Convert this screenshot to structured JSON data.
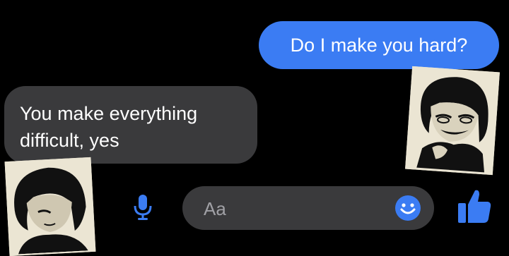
{
  "messages": [
    {
      "direction": "outgoing",
      "text": "Do I make you hard?"
    },
    {
      "direction": "incoming",
      "lines": [
        "You make everything",
        "difficult, yes"
      ]
    }
  ],
  "composer": {
    "placeholder": "Aa"
  },
  "icons": {
    "mic": "microphone-icon",
    "emoji": "smiley-emoji-icon",
    "send": "thumbs-up-icon"
  },
  "colors": {
    "background": "#000000",
    "outgoing_bubble": "#3b7cf3",
    "incoming_bubble": "#3a3a3c",
    "accent": "#3b7cf3",
    "sticker_paper": "#ebe5d3"
  }
}
